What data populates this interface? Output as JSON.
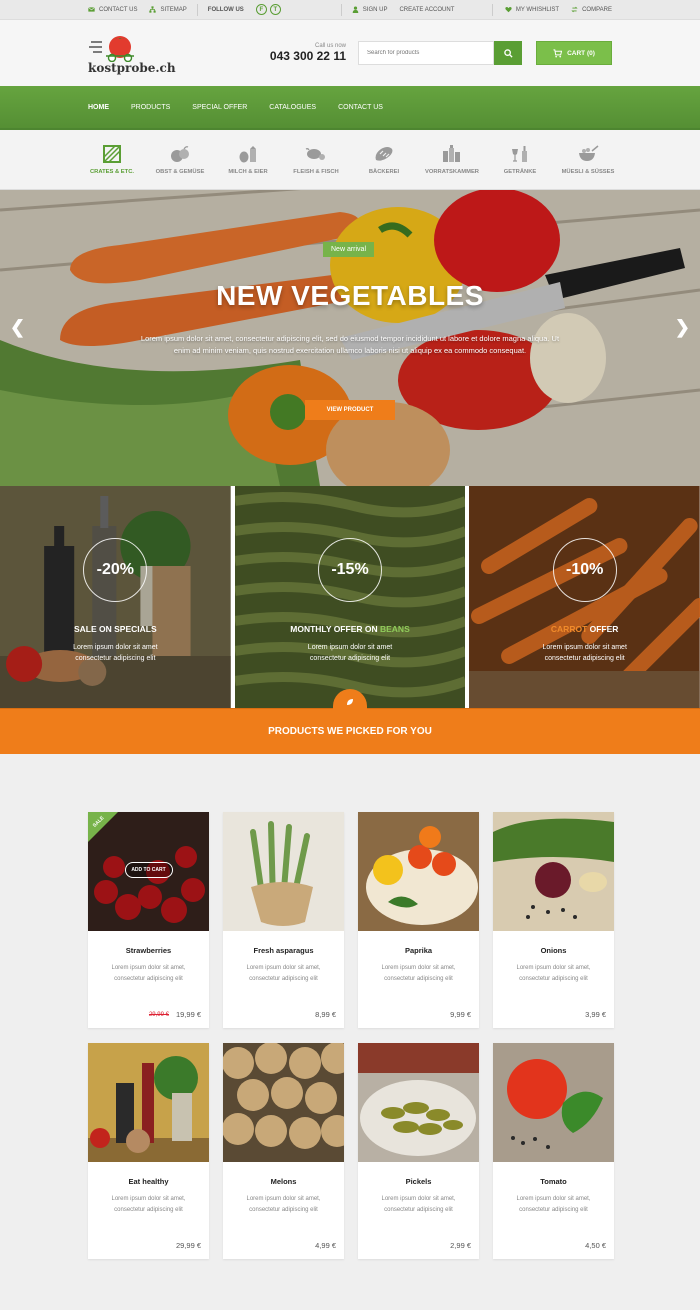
{
  "topbar": {
    "contact": "CONTACT US",
    "sitemap": "SITEMAP",
    "follow": "FOLLOW US",
    "social": [
      "f",
      "t"
    ],
    "signup": "SIGN UP",
    "create_account": "CREATE ACCOUNT",
    "wishlist": "MY WHISHLIST",
    "compare": "COMPARE"
  },
  "header": {
    "logo": "kostprobe.ch",
    "call_label": "Call us now",
    "phone": "043 300 22 11",
    "search_placeholder": "Search for products",
    "cart": "CART (0)"
  },
  "nav": [
    "HOME",
    "PRODUCTS",
    "SPECIAL OFFER",
    "CATALOGUES",
    "CONTACT US"
  ],
  "categories": [
    "CRATES & ETC.",
    "OBST & GEMÜSE",
    "MILCH & EIER",
    "FLEISH & FISCH",
    "BÄCKEREI",
    "VORRATSKAMMER",
    "GETRÄNKE",
    "MÜESLI & SÜSSES"
  ],
  "hero": {
    "badge": "New arrival",
    "title": "NEW VEGETABLES",
    "desc": "Lorem ipsum dolor sit amet, consectetur adipiscing elit, sed do eiusmod tempor incididunt ut labore et dolore magna aliqua. Ut enim ad minim veniam, quis nostrud exercitation ullamco laboris nisi ut aliquip ex ea commodo consequat.",
    "cta": "VIEW PRODUCT"
  },
  "promos": [
    {
      "discount": "-20%",
      "title_pre": "SALE ON SPECIALS",
      "title_hl": "",
      "title_post": "",
      "desc1": "Lorem ipsum dolor sit amet",
      "desc2": "consectetur adipiscing elit"
    },
    {
      "discount": "-15%",
      "title_pre": "MONTHLY OFFER ON ",
      "title_hl": "BEANS",
      "title_post": "",
      "desc1": "Lorem ipsum dolor sit amet",
      "desc2": "consectetur adipiscing elit"
    },
    {
      "discount": "-10%",
      "title_pre": "",
      "title_hl": "CARROT",
      "title_post": " OFFER",
      "desc1": "Lorem ipsum dolor sit amet",
      "desc2": "consectetur adipiscing elit"
    }
  ],
  "picked": "PRODUCTS WE PICKED FOR YOU",
  "products": [
    {
      "name": "Strawberries",
      "desc1": "Lorem ipsum dolor sit amet,",
      "desc2": "consectetur adipiscing elit",
      "price": "19,99 €",
      "old": "29,99 €",
      "sale": "SALE",
      "add": "ADD TO CART"
    },
    {
      "name": "Fresh asparagus",
      "desc1": "Lorem ipsum dolor sit amet,",
      "desc2": "consectetur adipiscing elit",
      "price": "8,99 €"
    },
    {
      "name": "Paprika",
      "desc1": "Lorem ipsum dolor sit amet,",
      "desc2": "consectetur adipiscing elit",
      "price": "9,99 €"
    },
    {
      "name": "Onions",
      "desc1": "Lorem ipsum dolor sit amet,",
      "desc2": "consectetur adipiscing elit",
      "price": "3,99 €"
    },
    {
      "name": "Eat healthy",
      "desc1": "Lorem ipsum dolor sit amet,",
      "desc2": "consectetur adipiscing elit",
      "price": "29,99 €"
    },
    {
      "name": "Melons",
      "desc1": "Lorem ipsum dolor sit amet,",
      "desc2": "consectetur adipiscing elit",
      "price": "4,99 €"
    },
    {
      "name": "Pickels",
      "desc1": "Lorem ipsum dolor sit amet,",
      "desc2": "consectetur adipiscing elit",
      "price": "2,99 €"
    },
    {
      "name": "Tomato",
      "desc1": "Lorem ipsum dolor sit amet,",
      "desc2": "consectetur adipiscing elit",
      "price": "4,50 €"
    }
  ],
  "colors": {
    "green": "#5a9e34",
    "orange": "#ef7d1a"
  }
}
